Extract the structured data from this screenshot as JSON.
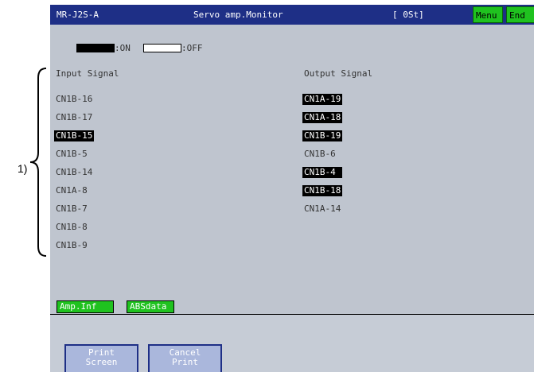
{
  "callout": "1)",
  "titlebar": {
    "model": "MR-J2S-A",
    "title": "Servo amp.Monitor",
    "status": "[ 0St]",
    "menu_label": "Menu",
    "end_label": "End"
  },
  "legend": {
    "on_label": ":ON",
    "off_label": ":OFF"
  },
  "input": {
    "header": "Input Signal",
    "signals": [
      {
        "label": "CN1B-16",
        "on": false
      },
      {
        "label": "CN1B-17",
        "on": false
      },
      {
        "label": "CN1B-15",
        "on": true
      },
      {
        "label": "CN1B-5",
        "on": false
      },
      {
        "label": "CN1B-14",
        "on": false
      },
      {
        "label": "CN1A-8",
        "on": false
      },
      {
        "label": "CN1B-7",
        "on": false
      },
      {
        "label": "CN1B-8",
        "on": false
      },
      {
        "label": "CN1B-9",
        "on": false
      }
    ]
  },
  "output": {
    "header": "Output Signal",
    "signals": [
      {
        "label": "CN1A-19",
        "on": true
      },
      {
        "label": "CN1A-18",
        "on": true
      },
      {
        "label": "CN1B-19",
        "on": true
      },
      {
        "label": "CN1B-6",
        "on": false
      },
      {
        "label": "CN1B-4 ",
        "on": true
      },
      {
        "label": "CN1B-18",
        "on": true
      },
      {
        "label": "CN1A-14",
        "on": false
      }
    ]
  },
  "tabs": {
    "amp_inf": "Amp.Inf",
    "abs_data": "ABSdata"
  },
  "buttons": {
    "print_line1": "Print",
    "print_line2": "Screen",
    "cancel_line1": "Cancel",
    "cancel_line2": "Print"
  },
  "colors": {
    "title_bg": "#1e2f86",
    "screen_bg": "#bfc5cf",
    "green_button": "#1fc21f",
    "signal_on": "#000000"
  }
}
